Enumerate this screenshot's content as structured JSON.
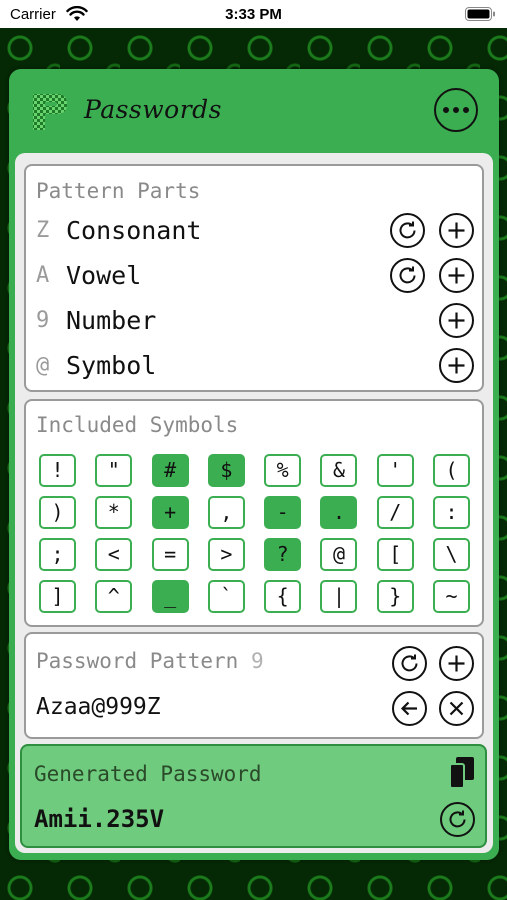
{
  "status_bar": {
    "carrier": "Carrier",
    "time": "3:33 PM"
  },
  "app": {
    "title": "Passwords",
    "logo_letter": "P",
    "accent": "#3cae52"
  },
  "pattern_parts": {
    "title": "Pattern Parts",
    "items": [
      {
        "key": "Z",
        "label": "Consonant",
        "has_refresh": true
      },
      {
        "key": "A",
        "label": "Vowel",
        "has_refresh": true
      },
      {
        "key": "9",
        "label": "Number",
        "has_refresh": false
      },
      {
        "key": "@",
        "label": "Symbol",
        "has_refresh": false
      }
    ]
  },
  "included_symbols": {
    "title": "Included Symbols",
    "symbols": [
      {
        "char": "!",
        "selected": false
      },
      {
        "char": "\"",
        "selected": false
      },
      {
        "char": "#",
        "selected": true
      },
      {
        "char": "$",
        "selected": true
      },
      {
        "char": "%",
        "selected": false
      },
      {
        "char": "&",
        "selected": false
      },
      {
        "char": "'",
        "selected": false
      },
      {
        "char": "(",
        "selected": false
      },
      {
        "char": ")",
        "selected": false
      },
      {
        "char": "*",
        "selected": false
      },
      {
        "char": "+",
        "selected": true
      },
      {
        "char": ",",
        "selected": false
      },
      {
        "char": "-",
        "selected": true
      },
      {
        "char": ".",
        "selected": true
      },
      {
        "char": "/",
        "selected": false
      },
      {
        "char": ":",
        "selected": false
      },
      {
        "char": ";",
        "selected": false
      },
      {
        "char": "<",
        "selected": false
      },
      {
        "char": "=",
        "selected": false
      },
      {
        "char": ">",
        "selected": false
      },
      {
        "char": "?",
        "selected": true
      },
      {
        "char": "@",
        "selected": false
      },
      {
        "char": "[",
        "selected": false
      },
      {
        "char": "\\",
        "selected": false
      },
      {
        "char": "]",
        "selected": false
      },
      {
        "char": "^",
        "selected": false
      },
      {
        "char": "_",
        "selected": true
      },
      {
        "char": "`",
        "selected": false
      },
      {
        "char": "{",
        "selected": false
      },
      {
        "char": "|",
        "selected": false
      },
      {
        "char": "}",
        "selected": false
      },
      {
        "char": "~",
        "selected": false
      }
    ]
  },
  "password_pattern": {
    "title": "Password Pattern",
    "count": "9",
    "value": "Azaa@999Z"
  },
  "generated_password": {
    "title": "Generated Password",
    "value": "Amii.235V"
  }
}
